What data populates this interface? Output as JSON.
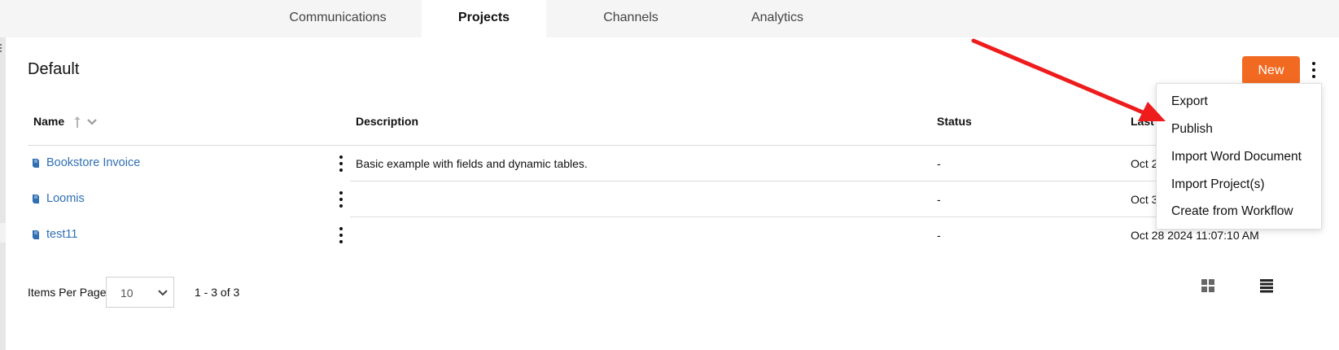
{
  "tabs": [
    {
      "label": "Communications",
      "active": false
    },
    {
      "label": "Projects",
      "active": true
    },
    {
      "label": "Channels",
      "active": false
    },
    {
      "label": "Analytics",
      "active": false
    }
  ],
  "page": {
    "title": "Default",
    "new_label": "New"
  },
  "table": {
    "columns": {
      "name": "Name",
      "description": "Description",
      "status": "Status",
      "last_modified": "Last I"
    },
    "rows": [
      {
        "name": "Bookstore Invoice",
        "description": "Basic example with fields and dynamic tables.",
        "status": "-",
        "last_modified": "Oct 2"
      },
      {
        "name": "Loomis",
        "description": "",
        "status": "-",
        "last_modified": "Oct 3"
      },
      {
        "name": "test11",
        "description": "",
        "status": "-",
        "last_modified": "Oct 28 2024 11:07:10 AM"
      }
    ]
  },
  "pagination": {
    "items_per_page_label": "Items Per Page",
    "items_per_page": "10",
    "range": "1 - 3 of 3"
  },
  "menu": {
    "items": [
      "Export",
      "Publish",
      "Import Word Document",
      "Import Project(s)",
      "Create from Workflow"
    ]
  },
  "colors": {
    "accent": "#f26a22",
    "link": "#2f6fb3",
    "arrow": "#ee1c1c"
  },
  "icons": [
    "book-icon",
    "kebab-icon",
    "sort-arrow-up-icon",
    "chevron-down-icon",
    "grid-view-icon",
    "list-view-icon",
    "red-arrow-annotation"
  ]
}
